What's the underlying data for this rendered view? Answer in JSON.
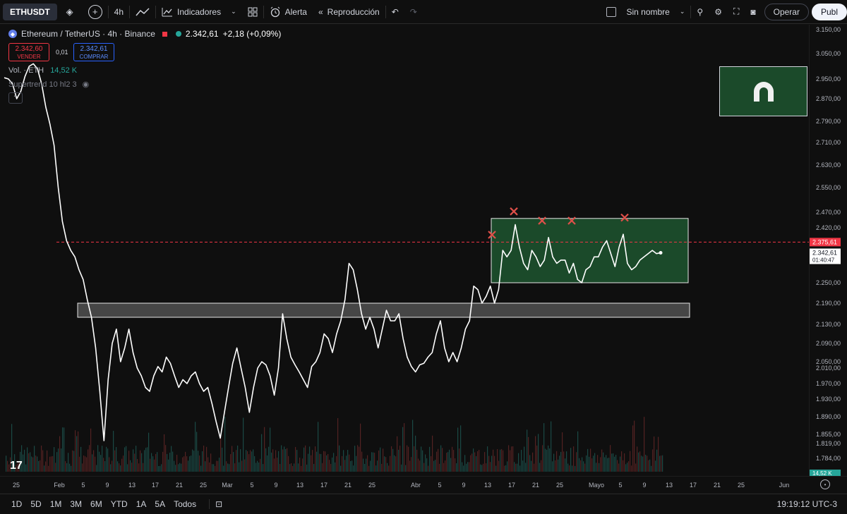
{
  "toolbar": {
    "symbol": "ETHUSDT",
    "interval": "4h",
    "indicators_label": "Indicadores",
    "alert_label": "Alerta",
    "replay_label": "Reproducción",
    "layout_name": "Sin nombre",
    "trade_label": "Operar",
    "publish_label": "Publ"
  },
  "legend": {
    "title": "Ethereum / TetherUS · 4h · Binance",
    "last_price": "2.342,61",
    "change": "+2,18 (+0,09%)",
    "sell_price": "2.342,60",
    "sell_label": "VENDER",
    "spread": "0,01",
    "buy_price": "2.342,61",
    "buy_label": "COMPRAR",
    "volume_label": "Vol. · ETH",
    "volume_value": "14,52 K",
    "indicator": "Supertrend 10 hl2 3"
  },
  "price_axis": {
    "ticks": [
      "3.150,00",
      "3.050,00",
      "2.950,00",
      "2.870,00",
      "2.790,00",
      "2.710,00",
      "2.630,00",
      "2.550,00",
      "2.470,00",
      "2.420,00",
      "2.250,00",
      "2.190,00",
      "2.130,00",
      "2.090,00",
      "2.050,00",
      "2.010,00",
      "1.970,00",
      "1.930,00",
      "1.890,00",
      "1.855,00",
      "1.819,00",
      "1.784,00"
    ],
    "level_tag": "2.375,61",
    "last_tag": "2.342,61",
    "countdown": "01:40:47",
    "volume_tag": "14,52 K"
  },
  "time_axis": {
    "ticks": [
      "25",
      "Feb",
      "5",
      "9",
      "13",
      "17",
      "21",
      "25",
      "Mar",
      "5",
      "9",
      "13",
      "17",
      "21",
      "25",
      "Abr",
      "5",
      "9",
      "13",
      "17",
      "21",
      "25",
      "Mayo",
      "5",
      "9",
      "13",
      "17",
      "21",
      "25",
      "Jun"
    ]
  },
  "bottom_bar": {
    "ranges": [
      "1D",
      "5D",
      "1M",
      "3M",
      "6M",
      "YTD",
      "1A",
      "5A",
      "Todos"
    ],
    "clock": "19:19:12 UTC-3"
  },
  "colors": {
    "background": "#0f0f0f",
    "line": "#ffffff",
    "zone_fill": "#1b4a2a",
    "support_fill": "#5a5a5a",
    "marker": "#e0504a",
    "level_line": "#f23645"
  },
  "chart_data": {
    "type": "line",
    "y_axis_ticks": [
      3150,
      3050,
      2950,
      2870,
      2790,
      2710,
      2630,
      2550,
      2470,
      2420,
      2250,
      2190,
      2130,
      2090,
      2050,
      2010,
      1970,
      1930,
      1890,
      1855,
      1819,
      1784
    ],
    "x_axis_ticks": [
      "25",
      "Feb",
      "5",
      "9",
      "13",
      "17",
      "21",
      "25",
      "Mar",
      "5",
      "9",
      "13",
      "17",
      "21",
      "25",
      "Abr",
      "5",
      "9",
      "13",
      "17",
      "21",
      "25",
      "Mayo",
      "5",
      "9",
      "13",
      "17",
      "21",
      "25",
      "Jun"
    ],
    "series": [
      {
        "values": [
          2955,
          2950,
          2930,
          2870,
          2900,
          2960,
          3000,
          3010,
          2990,
          2930,
          2840,
          2780,
          2700,
          2550,
          2440,
          2380,
          2350,
          2330,
          2290,
          2260,
          2200,
          2150,
          2080,
          1950,
          1830,
          1980,
          2090,
          2120,
          2050,
          2080,
          2120,
          2070,
          2010,
          1990,
          1960,
          1950,
          1990,
          2020,
          2000,
          2060,
          2040,
          1990,
          1960,
          1980,
          1970,
          1990,
          2000,
          1970,
          1950,
          1960,
          1920,
          1880,
          1840,
          1900,
          1960,
          2040,
          2080,
          2010,
          1960,
          1900,
          1960,
          2010,
          2050,
          2030,
          1990,
          1940,
          2010,
          2160,
          2100,
          2060,
          2030,
          2000,
          1980,
          1960,
          2020,
          2050,
          2070,
          2110,
          2100,
          2070,
          2110,
          2140,
          2200,
          2310,
          2290,
          2230,
          2160,
          2120,
          2150,
          2120,
          2080,
          2120,
          2170,
          2140,
          2140,
          2160,
          2100,
          2060,
          2020,
          2000,
          2030,
          2040,
          2060,
          2070,
          2110,
          2140,
          2080,
          2050,
          2070,
          2050,
          2080,
          2120,
          2140,
          2240,
          2230,
          2190,
          2210,
          2240,
          2190,
          2230,
          2350,
          2330,
          2350,
          2430,
          2360,
          2310,
          2290,
          2350,
          2330,
          2300,
          2320,
          2390,
          2330,
          2310,
          2320,
          2320,
          2280,
          2310,
          2260,
          2250,
          2290,
          2300,
          2330,
          2330,
          2360,
          2380,
          2340,
          2300,
          2360,
          2400,
          2310,
          2290,
          2300,
          2320,
          2330,
          2340,
          2350,
          2340,
          2342.61
        ],
        "color": "#ffffff"
      }
    ],
    "annotations": {
      "resistance_zone": {
        "from_date": "Abr 14",
        "to_date": "Mayo 24",
        "low": 2250,
        "high": 2450,
        "fill": "#1b4a2a"
      },
      "support_zone": {
        "from_date": "Feb 1",
        "to_date": "Mayo 24",
        "low": 2150,
        "high": 2190,
        "fill": "#5a5a5a"
      },
      "horizontal_level": 2375.61,
      "x_markers": [
        2420,
        2450,
        2420,
        2420,
        2430
      ]
    },
    "ylim": [
      1750,
      3170
    ],
    "grid": false,
    "last_price": 2342.61
  }
}
